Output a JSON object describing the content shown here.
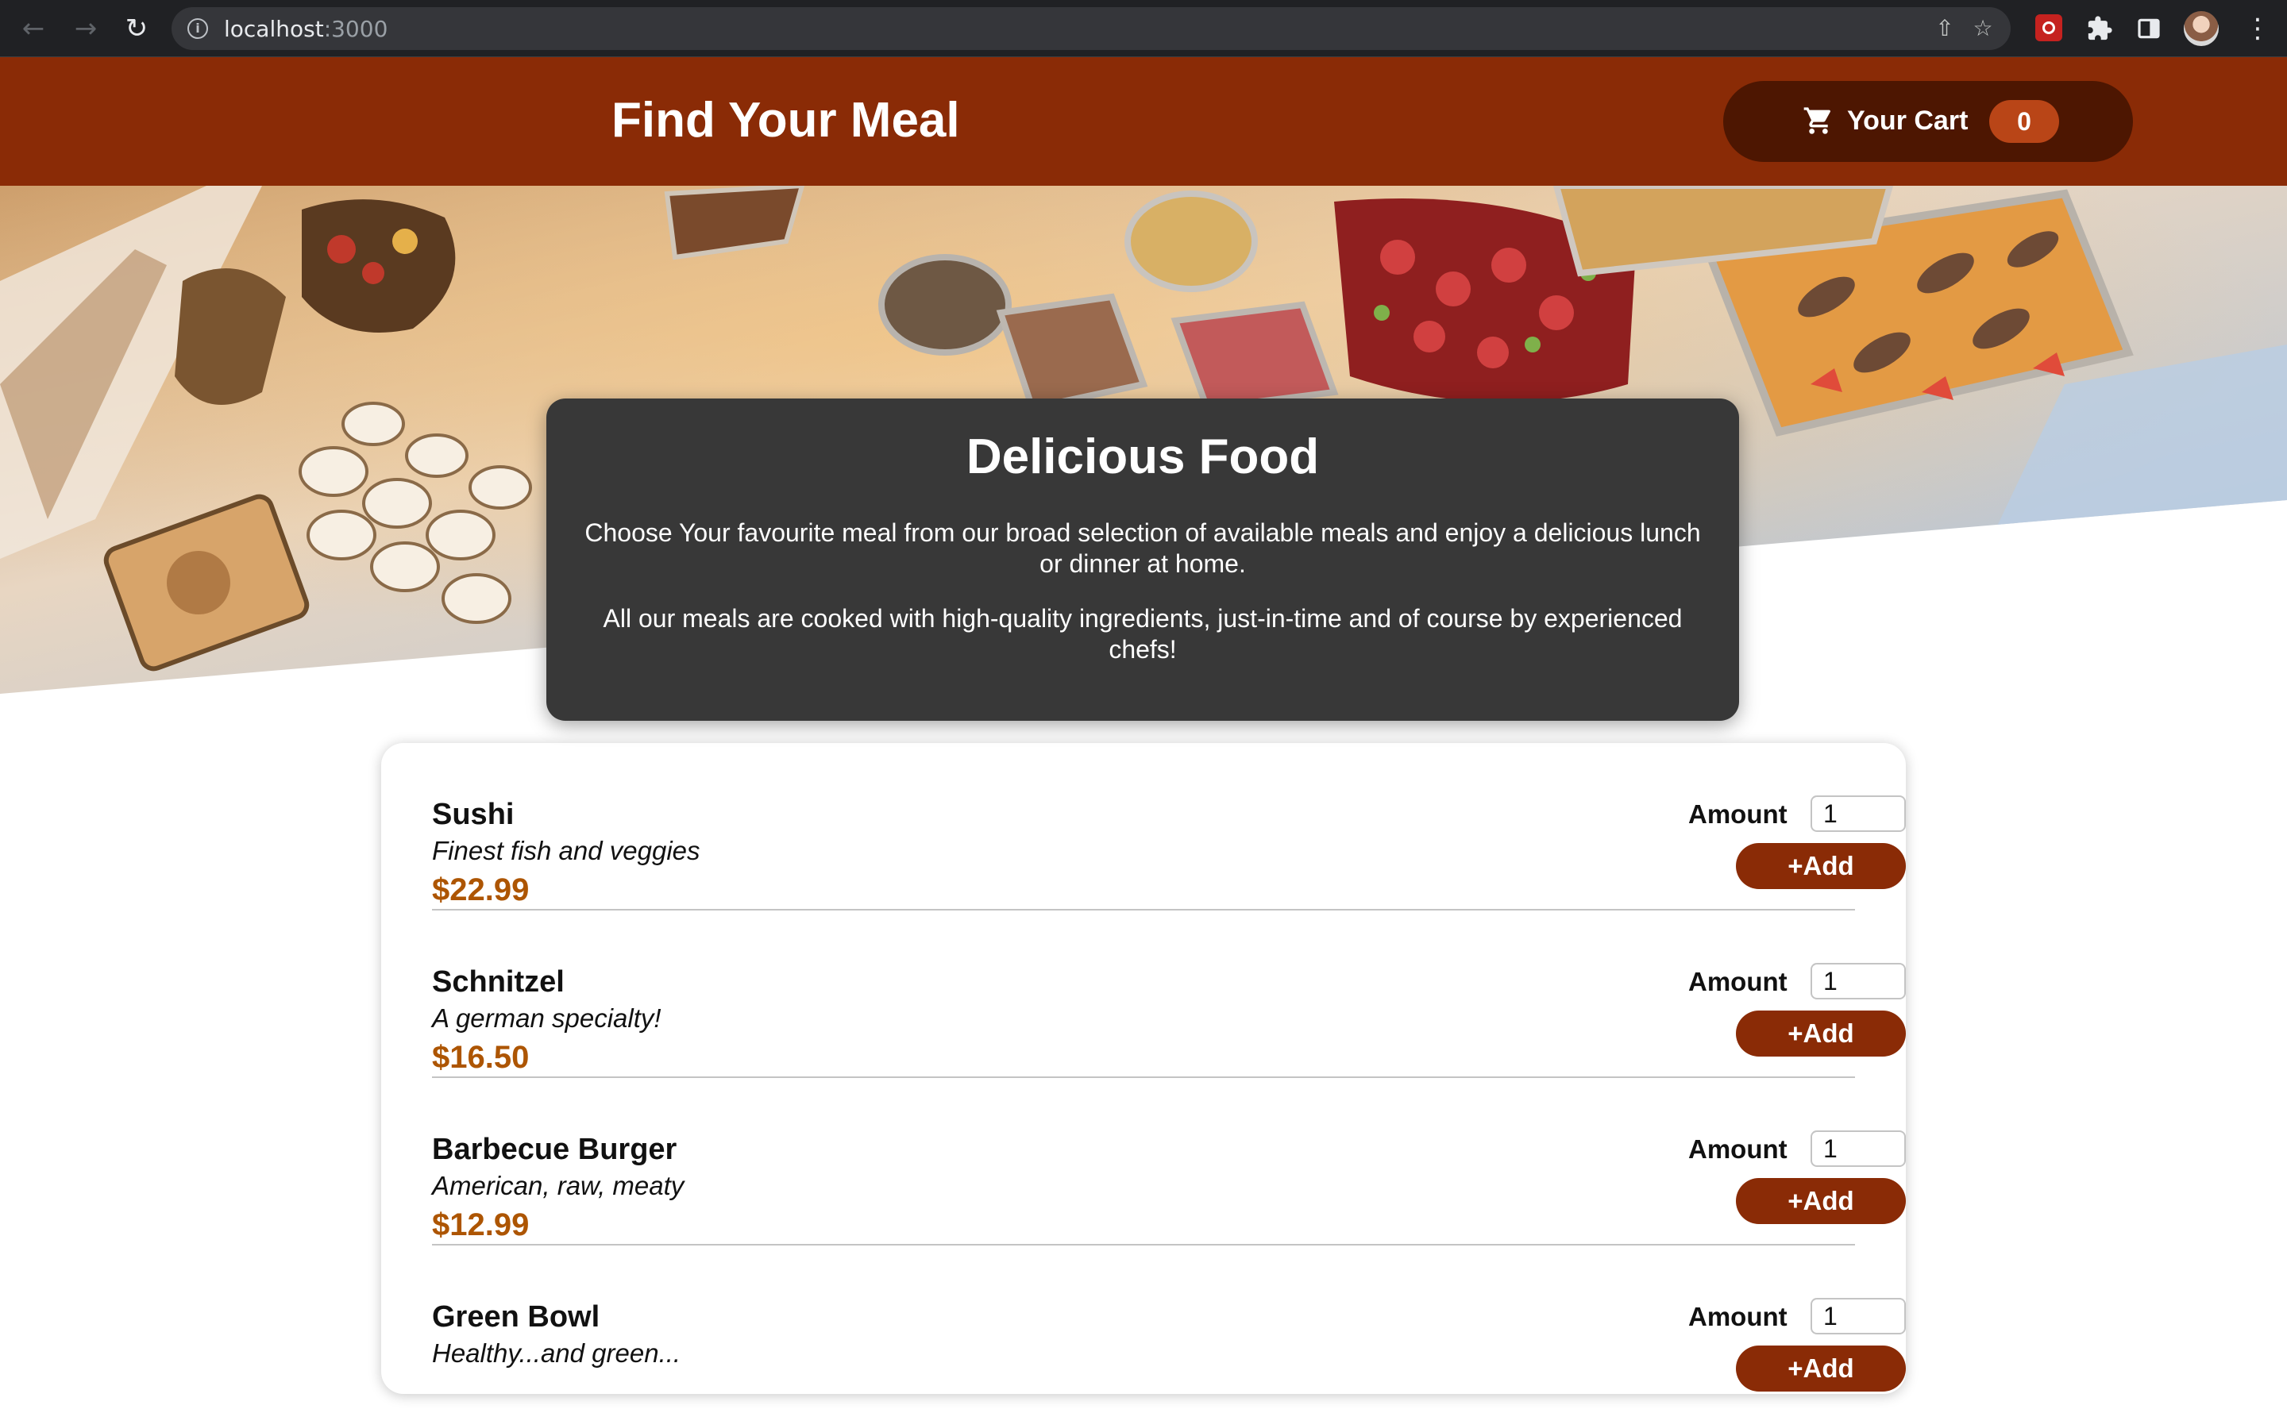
{
  "browser": {
    "url_host": "localhost",
    "url_port": ":3000",
    "back_icon": "arrow-left-icon",
    "forward_icon": "arrow-right-icon",
    "reload_icon": "reload-icon",
    "info_icon": "info-icon",
    "share_icon": "share-icon",
    "bookmark_icon": "star-icon",
    "extensions_icon": "puzzle-icon",
    "sidepanel_icon": "side-panel-icon",
    "menu_icon": "kebab-menu-icon"
  },
  "header": {
    "title": "Find Your Meal",
    "cart_label": "Your Cart",
    "cart_count": "0",
    "cart_icon": "cart-icon"
  },
  "summary": {
    "title": "Delicious Food",
    "paragraph1": "Choose Your favourite meal from our broad selection of available meals and enjoy a delicious lunch or dinner at home.",
    "paragraph2": "All our meals are cooked with high-quality ingredients, just-in-time and of course by experienced chefs!"
  },
  "meals": [
    {
      "name": "Sushi",
      "description": "Finest fish and veggies",
      "price": "$22.99",
      "amount_label": "Amount",
      "amount_value": "1",
      "add_label": "+Add"
    },
    {
      "name": "Schnitzel",
      "description": "A german specialty!",
      "price": "$16.50",
      "amount_label": "Amount",
      "amount_value": "1",
      "add_label": "+Add"
    },
    {
      "name": "Barbecue Burger",
      "description": "American, raw, meaty",
      "price": "$12.99",
      "amount_label": "Amount",
      "amount_value": "1",
      "add_label": "+Add"
    },
    {
      "name": "Green Bowl",
      "description": "Healthy...and green...",
      "price": "",
      "amount_label": "Amount",
      "amount_value": "1",
      "add_label": "+Add"
    }
  ],
  "colors": {
    "header_bg": "#8a2b06",
    "cart_bg": "#4d1601",
    "badge_bg": "#b94517",
    "price": "#ad5502",
    "summary_bg": "#383838"
  }
}
